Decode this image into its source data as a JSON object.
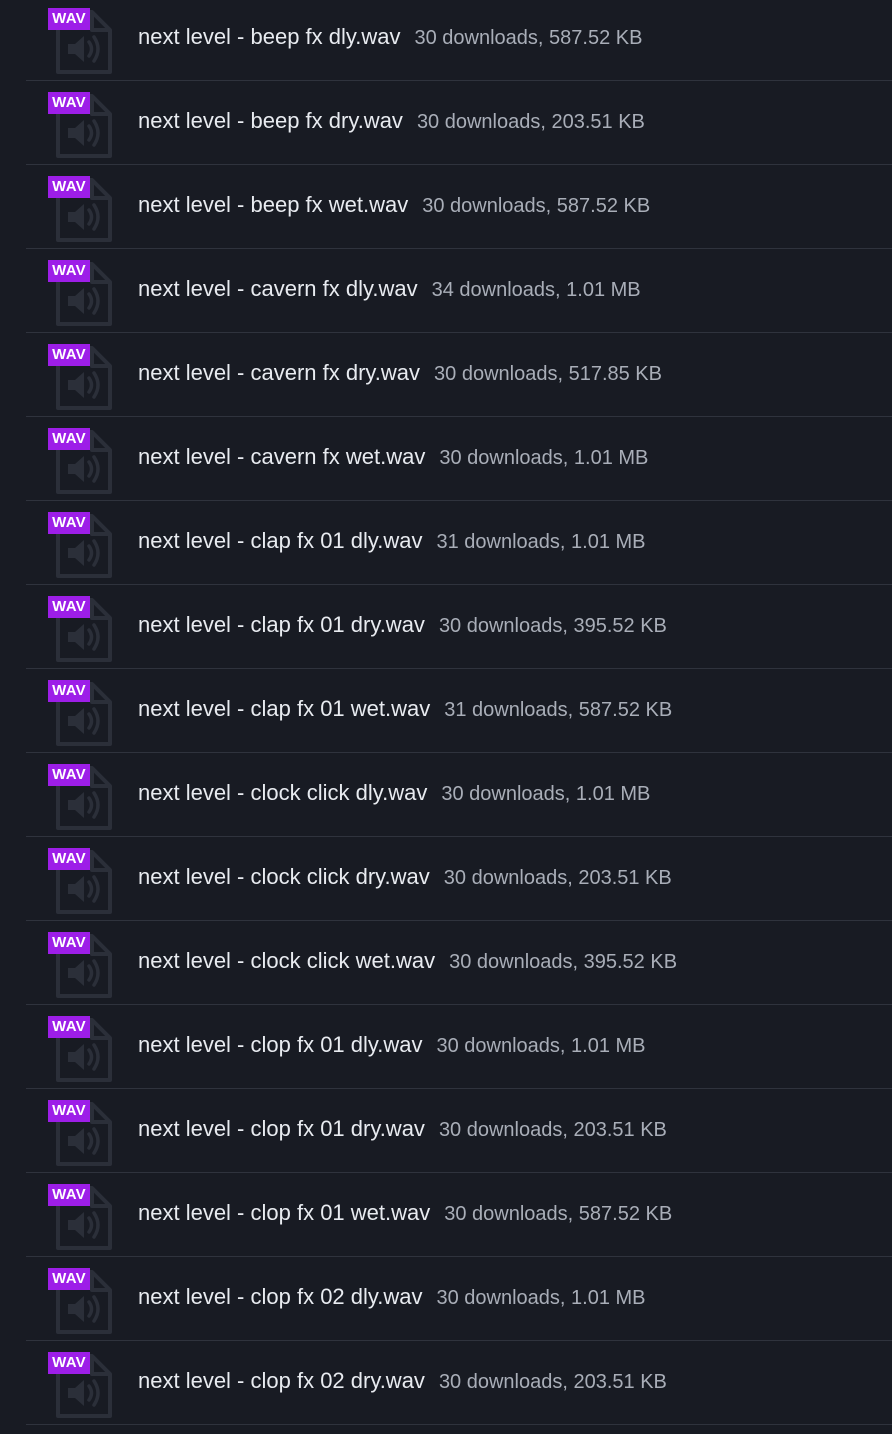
{
  "theme": {
    "background": "#181b23",
    "badge_color": "#9d1ee8",
    "divider_color": "#2f333d",
    "name_color": "#e8ebf0",
    "meta_color": "#a9aeb8"
  },
  "file_icon": "audio-file-icon",
  "files": [
    {
      "badge": "WAV",
      "name": "next level - beep fx dly.wav",
      "meta": "30 downloads, 587.52 KB"
    },
    {
      "badge": "WAV",
      "name": "next level - beep fx dry.wav",
      "meta": "30 downloads, 203.51 KB"
    },
    {
      "badge": "WAV",
      "name": "next level - beep fx wet.wav",
      "meta": "30 downloads, 587.52 KB"
    },
    {
      "badge": "WAV",
      "name": "next level - cavern fx dly.wav",
      "meta": "34 downloads, 1.01 MB"
    },
    {
      "badge": "WAV",
      "name": "next level - cavern fx dry.wav",
      "meta": "30 downloads, 517.85 KB"
    },
    {
      "badge": "WAV",
      "name": "next level - cavern fx wet.wav",
      "meta": "30 downloads, 1.01 MB"
    },
    {
      "badge": "WAV",
      "name": "next level - clap fx 01 dly.wav",
      "meta": "31 downloads, 1.01 MB"
    },
    {
      "badge": "WAV",
      "name": "next level - clap fx 01 dry.wav",
      "meta": "30 downloads, 395.52 KB"
    },
    {
      "badge": "WAV",
      "name": "next level - clap fx 01 wet.wav",
      "meta": "31 downloads, 587.52 KB"
    },
    {
      "badge": "WAV",
      "name": "next level - clock click dly.wav",
      "meta": "30 downloads, 1.01 MB"
    },
    {
      "badge": "WAV",
      "name": "next level - clock click dry.wav",
      "meta": "30 downloads, 203.51 KB"
    },
    {
      "badge": "WAV",
      "name": "next level - clock click wet.wav",
      "meta": "30 downloads, 395.52 KB"
    },
    {
      "badge": "WAV",
      "name": "next level - clop fx 01 dly.wav",
      "meta": "30 downloads, 1.01 MB"
    },
    {
      "badge": "WAV",
      "name": "next level - clop fx 01 dry.wav",
      "meta": "30 downloads, 203.51 KB"
    },
    {
      "badge": "WAV",
      "name": "next level - clop fx 01 wet.wav",
      "meta": "30 downloads, 587.52 KB"
    },
    {
      "badge": "WAV",
      "name": "next level - clop fx 02 dly.wav",
      "meta": "30 downloads, 1.01 MB"
    },
    {
      "badge": "WAV",
      "name": "next level - clop fx 02 dry.wav",
      "meta": "30 downloads, 203.51 KB"
    }
  ]
}
